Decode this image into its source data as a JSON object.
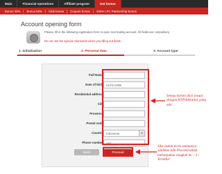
{
  "topnav": [
    "Main",
    "Financial operations",
    "Affiliate program",
    "Get bonus"
  ],
  "subnav": [
    "Bonus 30%",
    "Bonus 50%",
    "Club bonus",
    "Coupon bonus",
    "100% LFC Partnership Bonus"
  ],
  "page": {
    "title": "Account opening form",
    "intro": "Please, fill in the following registration form to open real trading account. All fields are compulsory.",
    "warning": "Do not use the special characters when you filling out fields."
  },
  "steps": [
    "1. Initialization",
    "2. Personal data",
    "3. Account type"
  ],
  "form": {
    "full_name": {
      "label": "Full Name",
      "value": ""
    },
    "dob": {
      "label": "Date of birth",
      "value": "01/01/1998"
    },
    "address": {
      "label": "Residential address",
      "value": ""
    },
    "city": {
      "label": "City",
      "value": ""
    },
    "province": {
      "label": "Provence",
      "value": ""
    },
    "postal": {
      "label": "Postal code",
      "value": ""
    },
    "country": {
      "label": "Country",
      "value": "Indonesia"
    },
    "phone": {
      "label": "Phone number",
      "value": "+62"
    }
  },
  "buttons": {
    "back": "Back",
    "proceed": "Proceed"
  },
  "annotations": {
    "fields_note": "Semua kolom diisi sesuai dengan KTP/Identitas yang ada",
    "proceed_note": "Jika sudah terisi semuanya silahkan klik Proceed untuk melanjutkan langkah ke – 3 / Terakhir"
  },
  "colors": {
    "brand_red": "#c8261f",
    "annotation_red": "#d82020",
    "nav_dark": "#2a2a2a"
  }
}
